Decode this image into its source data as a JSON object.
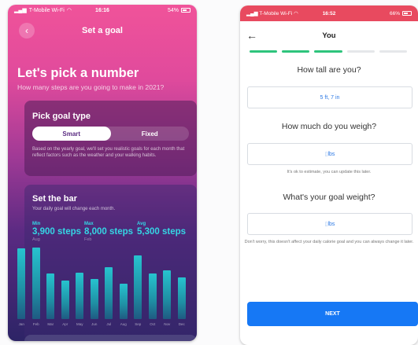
{
  "left": {
    "status": {
      "carrier": "T-Mobile Wi-Fi",
      "time": "16:16",
      "battery": "54%"
    },
    "nav": {
      "title": "Set a goal"
    },
    "hero": {
      "title": "Let's pick a number",
      "subtitle": "How many steps are you going to make in 2021?"
    },
    "goal_type": {
      "title": "Pick goal type",
      "options": [
        "Smart",
        "Fixed"
      ],
      "selected": "Smart",
      "description": "Based on the yearly goal, we'll set you realistic goals for each month that reflect factors such as the weather and your walking habits."
    },
    "bar_card": {
      "title": "Set the bar",
      "subtitle": "Your daily goal will change each month.",
      "stats": [
        {
          "label": "Min",
          "value": "3,900 steps",
          "month": "Aug"
        },
        {
          "label": "Max",
          "value": "8,000 steps",
          "month": "Feb"
        },
        {
          "label": "Avg",
          "value": "5,300 steps",
          "month": ""
        }
      ]
    },
    "chart_data": {
      "type": "bar",
      "categories": [
        "Jan",
        "Feb",
        "Mar",
        "Apr",
        "May",
        "Jun",
        "Jul",
        "Aug",
        "Sep",
        "Oct",
        "Nov",
        "Dec"
      ],
      "values": [
        7900,
        8000,
        5100,
        4300,
        5200,
        4500,
        5800,
        3900,
        7100,
        5100,
        5400,
        4600
      ],
      "ylim": [
        0,
        9800
      ],
      "accent_color": "#27c3cf"
    }
  },
  "right": {
    "status": {
      "carrier": "T-Mobile Wi-Fi",
      "time": "16:52",
      "battery": "66%"
    },
    "nav": {
      "title": "You"
    },
    "progress": {
      "total_steps": 5,
      "completed_steps": 3
    },
    "height": {
      "question": "How tall are you?",
      "value": "5 ft, 7 in"
    },
    "weight": {
      "question": "How much do you weigh?",
      "value": "lbs",
      "hint": "It's ok to estimate, you can update this later."
    },
    "goal_weight": {
      "question": "What's your goal weight?",
      "value": "lbs",
      "hint": "Don't worry, this doesn't affect your daily calorie goal and you can always change it later."
    },
    "next_label": "NEXT"
  }
}
